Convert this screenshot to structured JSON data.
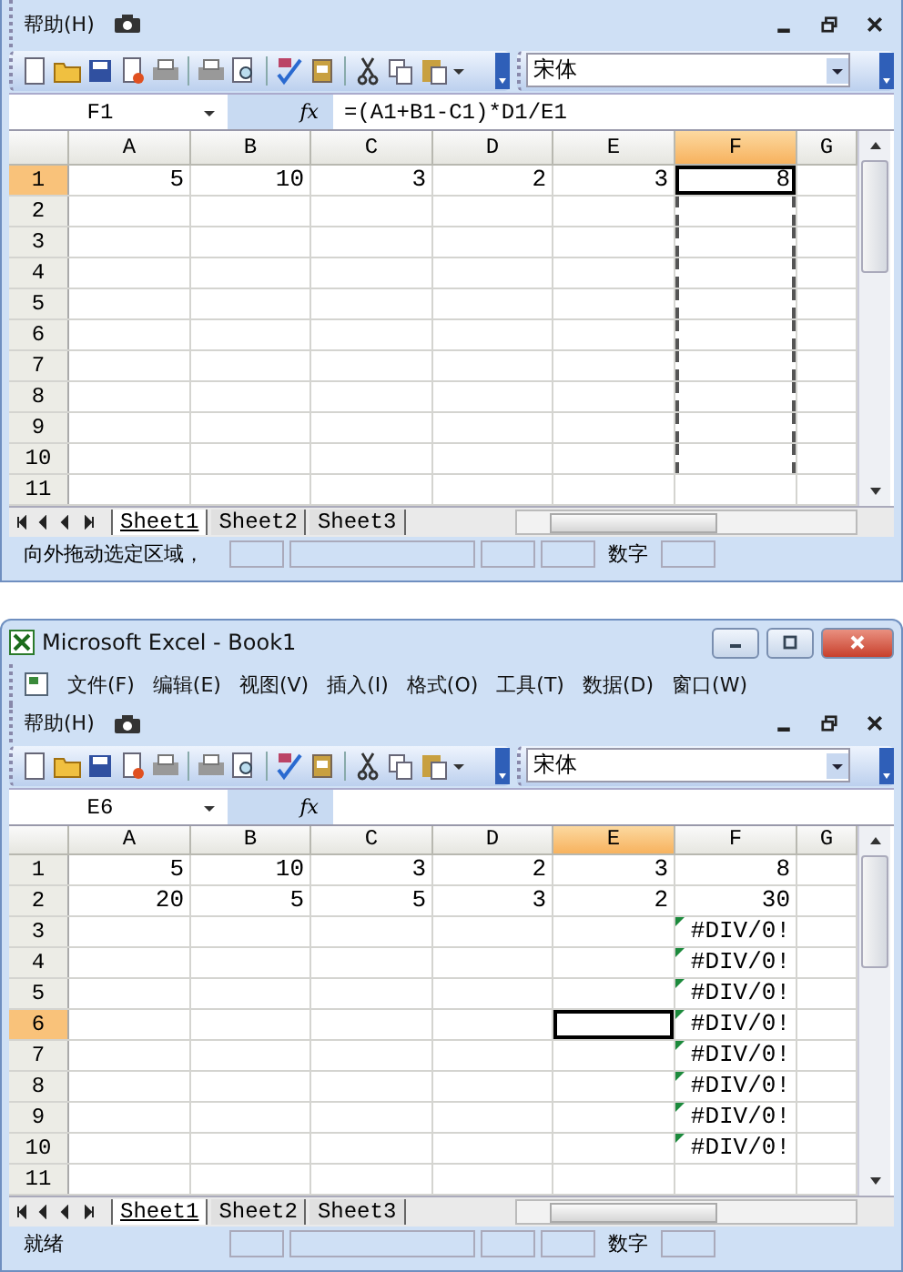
{
  "panels": [
    {
      "menu": [
        "帮助(H)"
      ],
      "font_box": "宋体",
      "name_box": "F1",
      "function_button": "fx",
      "formula": "=(A1+B1-C1)*D1/E1",
      "columns": [
        {
          "label": "A",
          "selected": false
        },
        {
          "label": "B",
          "selected": false
        },
        {
          "label": "C",
          "selected": false
        },
        {
          "label": "D",
          "selected": false
        },
        {
          "label": "E",
          "selected": false
        },
        {
          "label": "F",
          "selected": true
        },
        {
          "label": "G",
          "selected": false
        }
      ],
      "rows": [
        {
          "label": "1",
          "selected": true,
          "cells": [
            {
              "value": "5"
            },
            {
              "value": "10"
            },
            {
              "value": "3"
            },
            {
              "value": "2"
            },
            {
              "value": "3"
            },
            {
              "value": "8",
              "active": true
            }
          ]
        },
        {
          "label": "2",
          "selected": false,
          "cells": [
            null,
            null,
            null,
            null,
            null,
            {
              "marked": true
            }
          ]
        },
        {
          "label": "3",
          "selected": false,
          "cells": [
            null,
            null,
            null,
            null,
            null,
            {
              "marked": true
            }
          ]
        },
        {
          "label": "4",
          "selected": false,
          "cells": [
            null,
            null,
            null,
            null,
            null,
            {
              "marked": true
            }
          ]
        },
        {
          "label": "5",
          "selected": false,
          "cells": [
            null,
            null,
            null,
            null,
            null,
            {
              "marked": true
            }
          ]
        },
        {
          "label": "6",
          "selected": false,
          "cells": [
            null,
            null,
            null,
            null,
            null,
            {
              "marked": true
            }
          ]
        },
        {
          "label": "7",
          "selected": false,
          "cells": [
            null,
            null,
            null,
            null,
            null,
            {
              "marked": true
            }
          ]
        },
        {
          "label": "8",
          "selected": false,
          "cells": [
            null,
            null,
            null,
            null,
            null,
            {
              "marked": true
            }
          ]
        },
        {
          "label": "9",
          "selected": false,
          "cells": [
            null,
            null,
            null,
            null,
            null,
            {
              "marked": true
            }
          ]
        },
        {
          "label": "10",
          "selected": false,
          "cells": [
            null,
            null,
            null,
            null,
            null,
            {
              "marked": true
            }
          ]
        },
        {
          "label": "11",
          "selected": false,
          "cells": []
        }
      ],
      "sheets": [
        {
          "label": "Sheet1",
          "selected": true
        },
        {
          "label": "Sheet2",
          "selected": false
        },
        {
          "label": "Sheet3",
          "selected": false
        }
      ],
      "status": {
        "message": "向外拖动选定区域，",
        "mode": "数字"
      }
    },
    {
      "title_bar": "Microsoft Excel - Book1",
      "menu": [
        "文件(F)",
        "编辑(E)",
        "视图(V)",
        "插入(I)",
        "格式(O)",
        "工具(T)",
        "数据(D)",
        "窗口(W)",
        "帮助(H)"
      ],
      "font_box": "宋体",
      "name_box": "E6",
      "function_button": "fx",
      "columns": [
        {
          "label": "A",
          "selected": false
        },
        {
          "label": "B",
          "selected": false
        },
        {
          "label": "C",
          "selected": false
        },
        {
          "label": "D",
          "selected": false
        },
        {
          "label": "E",
          "selected": true
        },
        {
          "label": "F",
          "selected": false
        },
        {
          "label": "G",
          "selected": false
        }
      ],
      "rows": [
        {
          "label": "1",
          "selected": false,
          "cells": [
            {
              "value": "5"
            },
            {
              "value": "10"
            },
            {
              "value": "3"
            },
            {
              "value": "2"
            },
            {
              "value": "3"
            },
            {
              "value": "8"
            }
          ]
        },
        {
          "label": "2",
          "selected": false,
          "cells": [
            {
              "value": "20"
            },
            {
              "value": "5"
            },
            {
              "value": "5"
            },
            {
              "value": "3"
            },
            {
              "value": "2"
            },
            {
              "value": "30"
            }
          ]
        },
        {
          "label": "3",
          "selected": false,
          "cells": [
            null,
            null,
            null,
            null,
            null,
            {
              "value": "#DIV/0!",
              "flagged": true
            }
          ]
        },
        {
          "label": "4",
          "selected": false,
          "cells": [
            null,
            null,
            null,
            null,
            null,
            {
              "value": "#DIV/0!",
              "flagged": true
            }
          ]
        },
        {
          "label": "5",
          "selected": false,
          "cells": [
            null,
            null,
            null,
            null,
            null,
            {
              "value": "#DIV/0!",
              "flagged": true
            }
          ]
        },
        {
          "label": "6",
          "selected": true,
          "cells": [
            null,
            null,
            null,
            null,
            {
              "active": true
            },
            {
              "value": "#DIV/0!",
              "flagged": true
            }
          ]
        },
        {
          "label": "7",
          "selected": false,
          "cells": [
            null,
            null,
            null,
            null,
            null,
            {
              "value": "#DIV/0!",
              "flagged": true
            }
          ]
        },
        {
          "label": "8",
          "selected": false,
          "cells": [
            null,
            null,
            null,
            null,
            null,
            {
              "value": "#DIV/0!",
              "flagged": true
            }
          ]
        },
        {
          "label": "9",
          "selected": false,
          "cells": [
            null,
            null,
            null,
            null,
            null,
            {
              "value": "#DIV/0!",
              "flagged": true
            }
          ]
        },
        {
          "label": "10",
          "selected": false,
          "cells": [
            null,
            null,
            null,
            null,
            null,
            {
              "value": "#DIV/0!",
              "flagged": true
            }
          ]
        },
        {
          "label": "11",
          "selected": false,
          "cells": []
        }
      ],
      "sheets": [
        {
          "label": "Sheet1",
          "selected": true
        },
        {
          "label": "Sheet2",
          "selected": false
        },
        {
          "label": "Sheet3",
          "selected": false
        }
      ],
      "status": {
        "message": "就绪",
        "mode": "数字"
      }
    }
  ]
}
